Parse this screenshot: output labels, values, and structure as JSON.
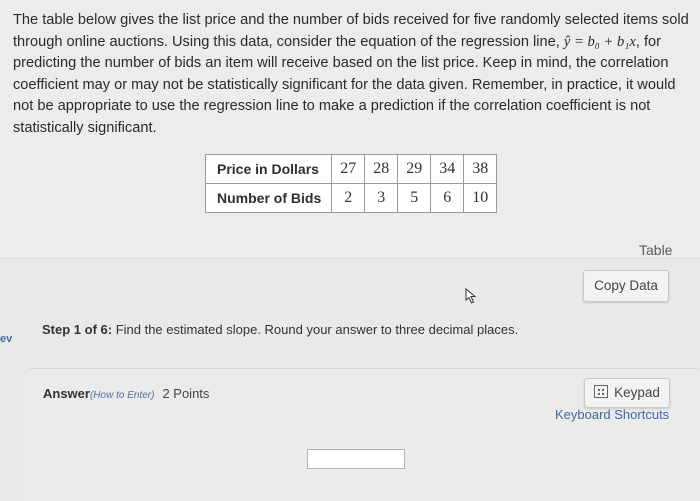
{
  "problem": {
    "text_before_eq": "The table below gives the list price and the number of bids received for five randomly selected items sold through online auctions. Using this data, consider the equation of the regression line, ",
    "equation": "ŷ = b₀ + b₁x",
    "text_after_eq": ", for predicting the number of bids an item will receive based on the list price. Keep in mind, the correlation coefficient may or may not be statistically significant for the data given. Remember, in practice, it would not be appropriate to use the regression line to make a prediction if the correlation coefficient is not statistically significant."
  },
  "table": {
    "rows": [
      {
        "label": "Price in Dollars",
        "values": [
          "27",
          "28",
          "29",
          "34",
          "38"
        ]
      },
      {
        "label": "Number of Bids",
        "values": [
          "2",
          "3",
          "5",
          "6",
          "10"
        ]
      }
    ]
  },
  "links": {
    "table": "Table",
    "copy_data": "Copy Data"
  },
  "side_label": "ev",
  "step": {
    "prefix": "Step 1 of 6:",
    "text": " Find the estimated slope. Round your answer to three decimal places."
  },
  "answer": {
    "label": "Answer",
    "how_to": "(How to Enter)",
    "points": "2 Points",
    "value": ""
  },
  "keypad": {
    "label": "Keypad",
    "icon": "keypad-icon"
  },
  "shortcuts": "Keyboard Shortcuts"
}
